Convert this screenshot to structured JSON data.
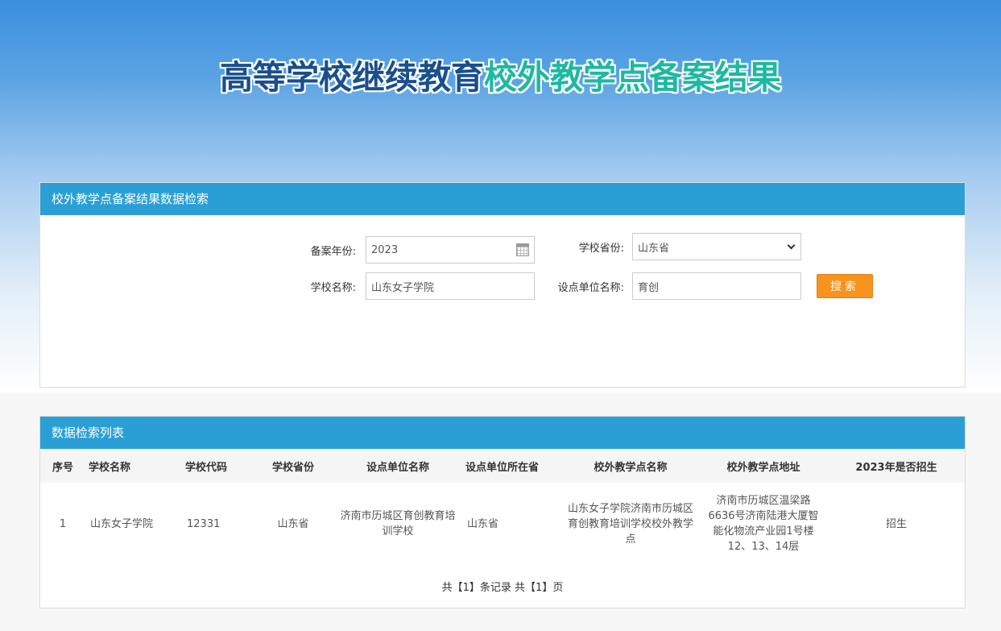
{
  "header": {
    "title_part1": "高等学校继续教育",
    "title_part2": "校外教学点备案结果"
  },
  "search": {
    "panel_title": "校外教学点备案结果数据检索",
    "year_label": "备案年份:",
    "year_value": "2023",
    "province_label": "学校省份:",
    "province_value": "山东省",
    "school_label": "学校名称:",
    "school_value": "山东女子学院",
    "unit_label": "设点单位名称:",
    "unit_value": "育创",
    "search_button": "搜索"
  },
  "list": {
    "panel_title": "数据检索列表",
    "columns": [
      "序号",
      "学校名称",
      "学校代码",
      "学校省份",
      "设点单位名称",
      "设点单位所在省",
      "校外教学点名称",
      "校外教学点地址",
      "2023年是否招生"
    ],
    "rows": [
      {
        "index": "1",
        "school_name": "山东女子学院",
        "school_code": "12331",
        "school_province": "山东省",
        "unit_name": "济南市历城区育创教育培训学校",
        "unit_province": "山东省",
        "site_name": "山东女子学院济南市历城区育创教育培训学校校外教学点",
        "site_address": "济南市历城区温梁路6636号济南陆港大厦智能化物流产业园1号楼12、13、14层",
        "enrolling": "招生"
      }
    ],
    "pager": "共【1】条记录 共【1】页"
  },
  "colors": {
    "panel_header": "#2a9fd6",
    "search_button": "#f7931e",
    "title_dark": "#1a4f8c",
    "title_teal": "#1fb8a2"
  }
}
